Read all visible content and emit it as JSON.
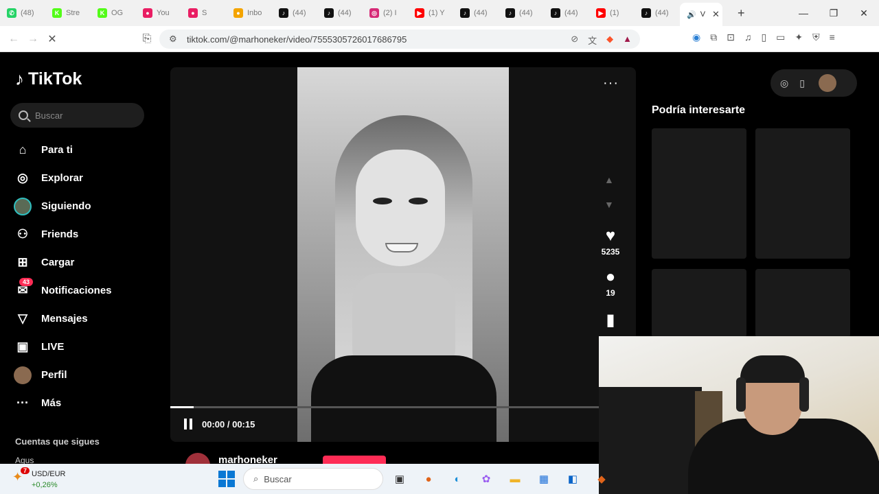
{
  "browser": {
    "tabs": [
      {
        "label": "(48)",
        "color": "#25d366",
        "glyph": "✆"
      },
      {
        "label": "Stre",
        "color": "#53fc18",
        "glyph": "K"
      },
      {
        "label": "OG",
        "color": "#53fc18",
        "glyph": "K"
      },
      {
        "label": "You",
        "color": "#e91e63",
        "glyph": "●"
      },
      {
        "label": "S",
        "color": "#e91e63",
        "glyph": "●"
      },
      {
        "label": "Inbo",
        "color": "#f4a400",
        "glyph": "●"
      },
      {
        "label": "(44)",
        "color": "#111111",
        "glyph": "♪"
      },
      {
        "label": "(44)",
        "color": "#111111",
        "glyph": "♪"
      },
      {
        "label": "(2) I",
        "color": "#d62976",
        "glyph": "◎"
      },
      {
        "label": "(1) Y",
        "color": "#ff0000",
        "glyph": "▶"
      },
      {
        "label": "(44)",
        "color": "#111111",
        "glyph": "♪"
      },
      {
        "label": "(44)",
        "color": "#111111",
        "glyph": "♪"
      },
      {
        "label": "(44)",
        "color": "#111111",
        "glyph": "♪"
      },
      {
        "label": "(1)",
        "color": "#ff0000",
        "glyph": "▶"
      },
      {
        "label": "(44)",
        "color": "#111111",
        "glyph": "♪"
      }
    ],
    "active_tab": {
      "label": "V",
      "icon": "speaker-icon",
      "close": "✕"
    },
    "new_tab": "+",
    "window_controls": {
      "minimize": "—",
      "restore": "❐",
      "close": "✕"
    },
    "url": "tiktok.com/@marhoneker/video/7555305726017686795"
  },
  "tiktok": {
    "brand": "TikTok",
    "search_placeholder": "Buscar",
    "nav": [
      {
        "label": "Para ti",
        "icon": "home-icon",
        "glyph": "⌂"
      },
      {
        "label": "Explorar",
        "icon": "compass-icon",
        "glyph": "◎"
      },
      {
        "label": "Siguiendo",
        "icon": "avatar",
        "glyph": ""
      },
      {
        "label": "Friends",
        "icon": "friends-icon",
        "glyph": "⚇"
      },
      {
        "label": "Cargar",
        "icon": "upload-icon",
        "glyph": "⊞"
      },
      {
        "label": "Notificaciones",
        "icon": "inbox-icon",
        "glyph": "✉"
      },
      {
        "label": "Mensajes",
        "icon": "send-icon",
        "glyph": "▽"
      },
      {
        "label": "LIVE",
        "icon": "live-icon",
        "glyph": "▣"
      },
      {
        "label": "Perfil",
        "icon": "profile-avatar",
        "glyph": ""
      },
      {
        "label": "Más",
        "icon": "more-icon",
        "glyph": "···"
      }
    ],
    "notification_count": "43",
    "following_header": "Cuentas que sigues",
    "following_first": "Agus",
    "video": {
      "time": "00:00 / 00:15",
      "progress": 0.05,
      "likes": "5235",
      "comments": "19",
      "author": "marhoneker",
      "more": "···"
    },
    "suggest_title": "Podría interesarte"
  },
  "taskbar": {
    "weather_badge": "7",
    "ticker": "USD/EUR",
    "change": "+0,26%",
    "search": "Buscar"
  }
}
